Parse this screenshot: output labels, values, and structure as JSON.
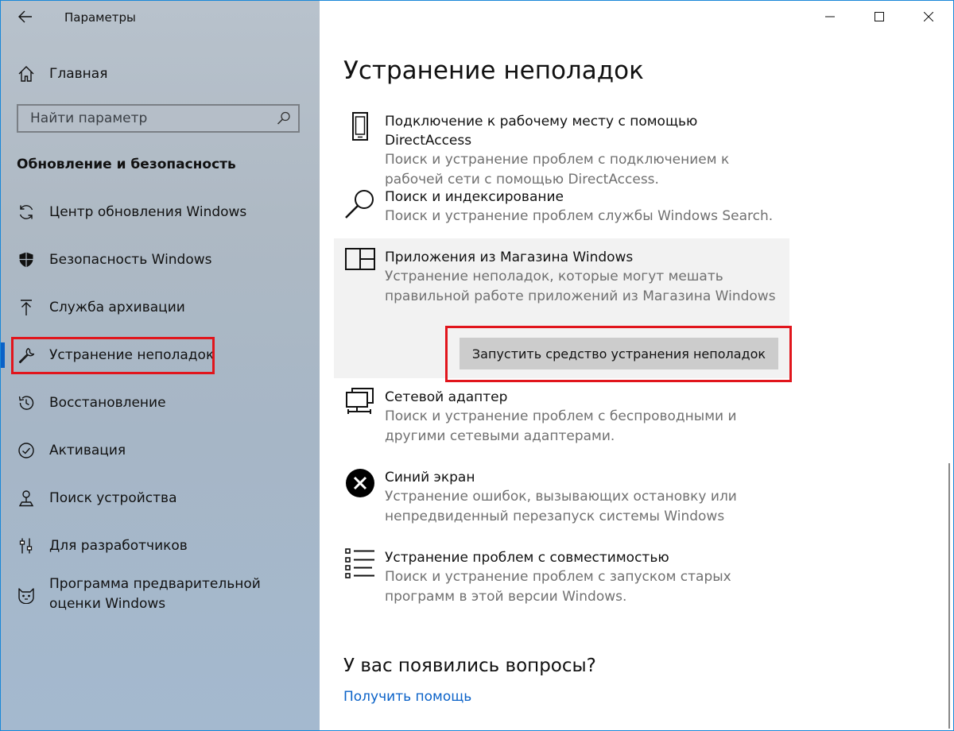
{
  "window": {
    "title": "Параметры"
  },
  "sidebar": {
    "home_label": "Главная",
    "search_placeholder": "Найти параметр",
    "section_heading": "Обновление и безопасность",
    "items": [
      {
        "label": "Центр обновления Windows",
        "icon": "refresh-icon"
      },
      {
        "label": "Безопасность Windows",
        "icon": "shield-icon"
      },
      {
        "label": "Служба архивации",
        "icon": "upload-arrow-icon"
      },
      {
        "label": "Устранение неполадок",
        "icon": "wrench-icon",
        "active": true
      },
      {
        "label": "Восстановление",
        "icon": "history-icon"
      },
      {
        "label": "Активация",
        "icon": "check-circle-icon"
      },
      {
        "label": "Поиск устройства",
        "icon": "person-pin-icon"
      },
      {
        "label": "Для разработчиков",
        "icon": "developer-sliders-icon"
      },
      {
        "label": "Программа предварительной оценки Windows",
        "icon": "insider-cat-icon"
      }
    ]
  },
  "main": {
    "page_title": "Устранение неполадок",
    "items": [
      {
        "title": "Подключение к рабочему месту с помощью DirectAccess",
        "description": "Поиск и устранение проблем с подключением к рабочей сети с помощью DirectAccess.",
        "icon": "phone-device-icon"
      },
      {
        "title": "Поиск и индексирование",
        "description": "Поиск и устранение проблем службы Windows Search.",
        "icon": "magnifier-icon"
      },
      {
        "title": "Приложения из Магазина Windows",
        "description": "Устранение неполадок, которые могут мешать правильной работе приложений из Магазина Windows",
        "icon": "store-apps-icon",
        "selected": true,
        "button_label": "Запустить средство устранения неполадок"
      },
      {
        "title": "Сетевой адаптер",
        "description": "Поиск и устранение проблем с беспроводными и другими сетевыми адаптерами.",
        "icon": "network-adapter-icon"
      },
      {
        "title": "Синий экран",
        "description": "Устранение ошибок, вызывающих остановку или непредвиденный перезапуск системы Windows",
        "icon": "error-x-circle-icon"
      },
      {
        "title": "Устранение проблем с совместимостью",
        "description": "Поиск и устранение проблем с запуском старых программ в этой версии Windows.",
        "icon": "checklist-icon"
      }
    ],
    "questions_title": "У вас появились вопросы?",
    "help_link": "Получить помощь"
  },
  "colors": {
    "accent": "#0a62c8",
    "highlight_red": "#e1151c",
    "window_border": "#1a88d8"
  }
}
